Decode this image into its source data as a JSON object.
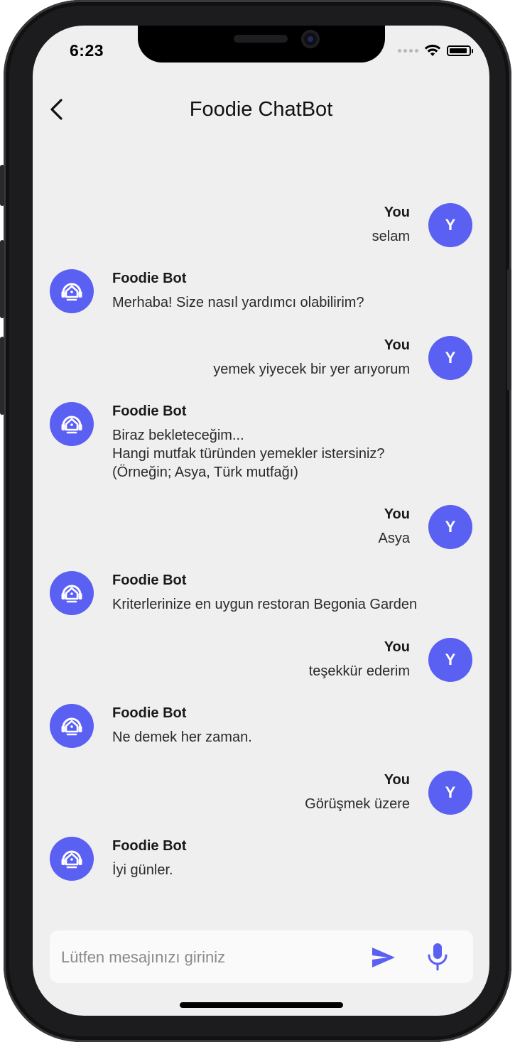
{
  "status_bar": {
    "time": "6:23"
  },
  "header": {
    "title": "Foodie ChatBot"
  },
  "messages": [
    {
      "sender": "user",
      "name": "You",
      "avatar_letter": "Y",
      "lines": [
        "selam"
      ]
    },
    {
      "sender": "bot",
      "name": "Foodie Bot",
      "lines": [
        "Merhaba! Size nasıl yardımcı olabilirim?"
      ]
    },
    {
      "sender": "user",
      "name": "You",
      "avatar_letter": "Y",
      "lines": [
        "yemek yiyecek bir yer arıyorum"
      ]
    },
    {
      "sender": "bot",
      "name": "Foodie Bot",
      "lines": [
        "Biraz bekleteceğim...",
        "Hangi mutfak türünden yemekler istersiniz?",
        "(Örneğin; Asya, Türk mutfağı)"
      ]
    },
    {
      "sender": "user",
      "name": "You",
      "avatar_letter": "Y",
      "lines": [
        "Asya"
      ]
    },
    {
      "sender": "bot",
      "name": "Foodie Bot",
      "lines": [
        "Kriterlerinize en uygun restoran Begonia Garden"
      ]
    },
    {
      "sender": "user",
      "name": "You",
      "avatar_letter": "Y",
      "lines": [
        "teşekkür ederim"
      ]
    },
    {
      "sender": "bot",
      "name": "Foodie Bot",
      "lines": [
        "Ne demek her zaman."
      ]
    },
    {
      "sender": "user",
      "name": "You",
      "avatar_letter": "Y",
      "lines": [
        "Görüşmek üzere"
      ]
    },
    {
      "sender": "bot",
      "name": "Foodie Bot",
      "lines": [
        "İyi günler."
      ]
    }
  ],
  "input": {
    "placeholder": "Lütfen mesajınızı giriniz",
    "value": ""
  },
  "colors": {
    "accent": "#5a60f2",
    "background": "#efefef",
    "input_bg": "#fafafa"
  },
  "icons": {
    "back": "chevron-left-icon",
    "bot_avatar": "support-agent-icon",
    "send": "send-icon",
    "mic": "microphone-icon",
    "wifi": "wifi-icon",
    "battery": "battery-icon"
  }
}
